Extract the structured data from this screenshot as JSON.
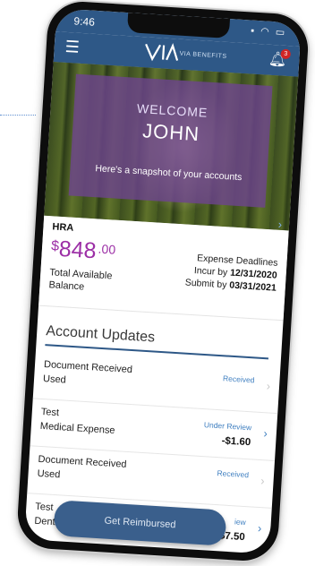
{
  "status_bar": {
    "time": "9:46"
  },
  "header": {
    "logo_text": "VIA BENEFITS",
    "notification_count": "3"
  },
  "hero": {
    "welcome": "WELCOME",
    "name": "JOHN",
    "subtitle": "Here's a snapshot of your accounts"
  },
  "account": {
    "type": "HRA",
    "currency": "$",
    "amount": "848",
    "cents": ".00",
    "available_label": "Total Available Balance",
    "deadlines_label": "Expense Deadlines",
    "incur_label": "Incur by",
    "incur_date": "12/31/2020",
    "submit_label": "Submit by",
    "submit_date": "03/31/2021"
  },
  "updates": {
    "title": "Account Updates",
    "rows": [
      {
        "title": "Document Received",
        "sub": "Used",
        "status": "Received",
        "amount": ""
      },
      {
        "title": "Test",
        "sub": "Medical Expense",
        "status": "Under Review",
        "amount": "-$1.60"
      },
      {
        "title": "Document Received",
        "sub": "Used",
        "status": "Received",
        "amount": ""
      },
      {
        "title": "Test",
        "sub": "Dental Expense",
        "status": "iew",
        "amount": "-$7.50"
      }
    ]
  },
  "actions": {
    "reimburse_label": "Get Reimbursed"
  },
  "colors": {
    "brand": "#2e5887",
    "accent_amount": "#9c2fa6",
    "status": "#3f7fc0"
  }
}
